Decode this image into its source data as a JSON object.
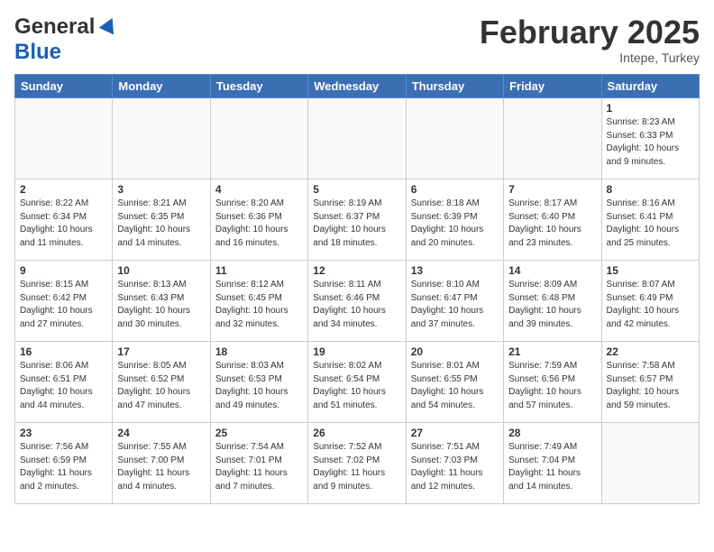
{
  "header": {
    "logo_general": "General",
    "logo_blue": "Blue",
    "month_title": "February 2025",
    "subtitle": "Intepe, Turkey"
  },
  "weekdays": [
    "Sunday",
    "Monday",
    "Tuesday",
    "Wednesday",
    "Thursday",
    "Friday",
    "Saturday"
  ],
  "weeks": [
    [
      {
        "day": "",
        "info": ""
      },
      {
        "day": "",
        "info": ""
      },
      {
        "day": "",
        "info": ""
      },
      {
        "day": "",
        "info": ""
      },
      {
        "day": "",
        "info": ""
      },
      {
        "day": "",
        "info": ""
      },
      {
        "day": "1",
        "info": "Sunrise: 8:23 AM\nSunset: 6:33 PM\nDaylight: 10 hours and 9 minutes."
      }
    ],
    [
      {
        "day": "2",
        "info": "Sunrise: 8:22 AM\nSunset: 6:34 PM\nDaylight: 10 hours and 11 minutes."
      },
      {
        "day": "3",
        "info": "Sunrise: 8:21 AM\nSunset: 6:35 PM\nDaylight: 10 hours and 14 minutes."
      },
      {
        "day": "4",
        "info": "Sunrise: 8:20 AM\nSunset: 6:36 PM\nDaylight: 10 hours and 16 minutes."
      },
      {
        "day": "5",
        "info": "Sunrise: 8:19 AM\nSunset: 6:37 PM\nDaylight: 10 hours and 18 minutes."
      },
      {
        "day": "6",
        "info": "Sunrise: 8:18 AM\nSunset: 6:39 PM\nDaylight: 10 hours and 20 minutes."
      },
      {
        "day": "7",
        "info": "Sunrise: 8:17 AM\nSunset: 6:40 PM\nDaylight: 10 hours and 23 minutes."
      },
      {
        "day": "8",
        "info": "Sunrise: 8:16 AM\nSunset: 6:41 PM\nDaylight: 10 hours and 25 minutes."
      }
    ],
    [
      {
        "day": "9",
        "info": "Sunrise: 8:15 AM\nSunset: 6:42 PM\nDaylight: 10 hours and 27 minutes."
      },
      {
        "day": "10",
        "info": "Sunrise: 8:13 AM\nSunset: 6:43 PM\nDaylight: 10 hours and 30 minutes."
      },
      {
        "day": "11",
        "info": "Sunrise: 8:12 AM\nSunset: 6:45 PM\nDaylight: 10 hours and 32 minutes."
      },
      {
        "day": "12",
        "info": "Sunrise: 8:11 AM\nSunset: 6:46 PM\nDaylight: 10 hours and 34 minutes."
      },
      {
        "day": "13",
        "info": "Sunrise: 8:10 AM\nSunset: 6:47 PM\nDaylight: 10 hours and 37 minutes."
      },
      {
        "day": "14",
        "info": "Sunrise: 8:09 AM\nSunset: 6:48 PM\nDaylight: 10 hours and 39 minutes."
      },
      {
        "day": "15",
        "info": "Sunrise: 8:07 AM\nSunset: 6:49 PM\nDaylight: 10 hours and 42 minutes."
      }
    ],
    [
      {
        "day": "16",
        "info": "Sunrise: 8:06 AM\nSunset: 6:51 PM\nDaylight: 10 hours and 44 minutes."
      },
      {
        "day": "17",
        "info": "Sunrise: 8:05 AM\nSunset: 6:52 PM\nDaylight: 10 hours and 47 minutes."
      },
      {
        "day": "18",
        "info": "Sunrise: 8:03 AM\nSunset: 6:53 PM\nDaylight: 10 hours and 49 minutes."
      },
      {
        "day": "19",
        "info": "Sunrise: 8:02 AM\nSunset: 6:54 PM\nDaylight: 10 hours and 51 minutes."
      },
      {
        "day": "20",
        "info": "Sunrise: 8:01 AM\nSunset: 6:55 PM\nDaylight: 10 hours and 54 minutes."
      },
      {
        "day": "21",
        "info": "Sunrise: 7:59 AM\nSunset: 6:56 PM\nDaylight: 10 hours and 57 minutes."
      },
      {
        "day": "22",
        "info": "Sunrise: 7:58 AM\nSunset: 6:57 PM\nDaylight: 10 hours and 59 minutes."
      }
    ],
    [
      {
        "day": "23",
        "info": "Sunrise: 7:56 AM\nSunset: 6:59 PM\nDaylight: 11 hours and 2 minutes."
      },
      {
        "day": "24",
        "info": "Sunrise: 7:55 AM\nSunset: 7:00 PM\nDaylight: 11 hours and 4 minutes."
      },
      {
        "day": "25",
        "info": "Sunrise: 7:54 AM\nSunset: 7:01 PM\nDaylight: 11 hours and 7 minutes."
      },
      {
        "day": "26",
        "info": "Sunrise: 7:52 AM\nSunset: 7:02 PM\nDaylight: 11 hours and 9 minutes."
      },
      {
        "day": "27",
        "info": "Sunrise: 7:51 AM\nSunset: 7:03 PM\nDaylight: 11 hours and 12 minutes."
      },
      {
        "day": "28",
        "info": "Sunrise: 7:49 AM\nSunset: 7:04 PM\nDaylight: 11 hours and 14 minutes."
      },
      {
        "day": "",
        "info": ""
      }
    ]
  ]
}
